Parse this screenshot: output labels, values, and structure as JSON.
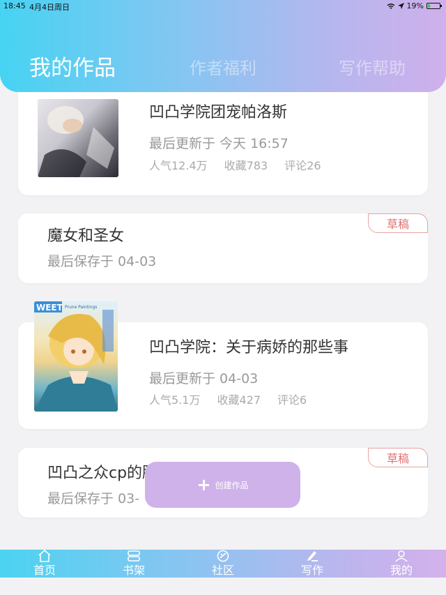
{
  "status_bar": {
    "time": "18:45",
    "date": "4月4日周日",
    "battery": "19%",
    "battery_level": 0.19
  },
  "tabs": [
    {
      "label": "我的作品",
      "active": true
    },
    {
      "label": "作者福利",
      "active": false
    },
    {
      "label": "写作帮助",
      "active": false
    }
  ],
  "works": [
    {
      "title": "凹凸学院团宠帕洛斯",
      "meta": "最后更新于 今天 16:57",
      "popularity": "人气12.4万",
      "favorites": "收藏783",
      "comments": "评论26"
    },
    {
      "title": "魔女和圣女",
      "meta": "最后保存于 04-03",
      "badge": "草稿"
    },
    {
      "title": "凹凸学院：关于病娇的那些事",
      "meta": "最后更新于 04-03",
      "popularity": "人气5.1万",
      "favorites": "收藏427",
      "comments": "评论6",
      "cover_text": "WEET",
      "cover_subtext": "Prune Paintings"
    },
    {
      "title": "凹凸之众cp的脑洞",
      "meta": "最后保存于 03-",
      "badge": "草稿"
    }
  ],
  "create_button": {
    "label": "创建作品",
    "icon": "plus-icon"
  },
  "bottom_nav": [
    {
      "label": "首页",
      "icon": "home-icon"
    },
    {
      "label": "书架",
      "icon": "bookshelf-icon"
    },
    {
      "label": "社区",
      "icon": "community-icon"
    },
    {
      "label": "写作",
      "icon": "write-icon",
      "active": true
    },
    {
      "label": "我的",
      "icon": "profile-icon"
    }
  ],
  "colors": {
    "header_gradient_start": "#46d3f2",
    "header_gradient_end": "#cfb0ec",
    "create_button": "#cfb2ea",
    "draft_badge": "#e07272"
  }
}
